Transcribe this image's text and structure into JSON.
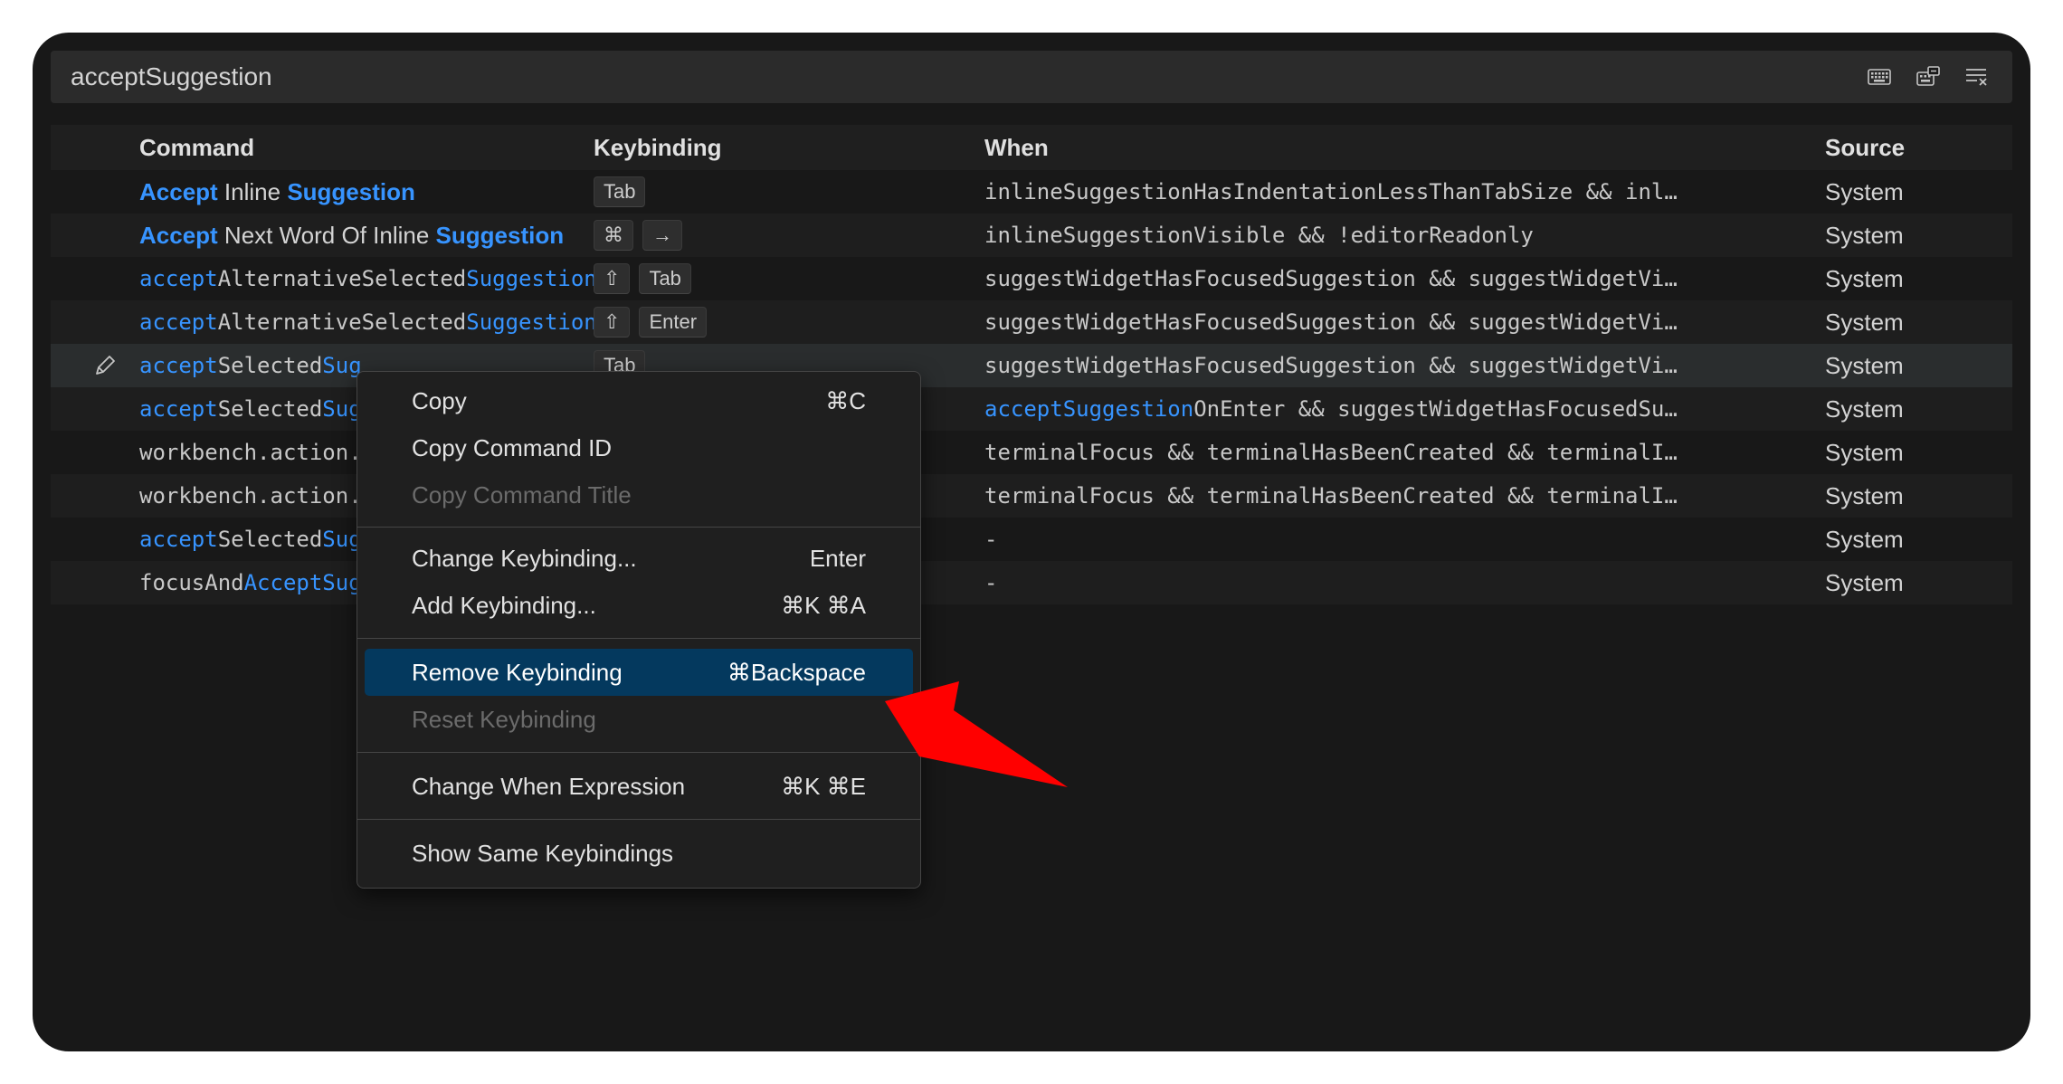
{
  "search": {
    "value": "acceptSuggestion"
  },
  "toolbar": {
    "keyboard_icon": "keyboard-icon",
    "record_keys_icon": "record-keys-icon",
    "clear_icon": "clear-search-icon"
  },
  "table": {
    "headers": {
      "command": "Command",
      "keybinding": "Keybinding",
      "when": "When",
      "source": "Source"
    },
    "rows": [
      {
        "cmd": [
          {
            "t": "Accept",
            "s": "hlb"
          },
          {
            "t": " Inline ",
            "s": "sans"
          },
          {
            "t": "Suggestion",
            "s": "hlb"
          }
        ],
        "keys": [
          "Tab"
        ],
        "when": [
          {
            "t": "inlineSuggestionHasIndentationLessThanTabSize && inl…",
            "s": ""
          }
        ],
        "source": "System"
      },
      {
        "cmd": [
          {
            "t": "Accept",
            "s": "hlb"
          },
          {
            "t": " Next Word Of Inline ",
            "s": "sans"
          },
          {
            "t": "Suggestion",
            "s": "hlb"
          }
        ],
        "keys": [
          "⌘",
          "→"
        ],
        "when": [
          {
            "t": "inlineSuggestionVisible && !editorReadonly",
            "s": ""
          }
        ],
        "source": "System"
      },
      {
        "cmd": [
          {
            "t": "accept",
            "s": "hl"
          },
          {
            "t": "AlternativeSelected",
            "s": ""
          },
          {
            "t": "Suggestion",
            "s": "hl"
          }
        ],
        "keys": [
          "⇧",
          "Tab"
        ],
        "when": [
          {
            "t": "suggestWidgetHasFocusedSuggestion && suggestWidgetVi…",
            "s": ""
          }
        ],
        "source": "System"
      },
      {
        "cmd": [
          {
            "t": "accept",
            "s": "hl"
          },
          {
            "t": "AlternativeSelected",
            "s": ""
          },
          {
            "t": "Suggestion",
            "s": "hl"
          }
        ],
        "keys": [
          "⇧",
          "Enter"
        ],
        "when": [
          {
            "t": "suggestWidgetHasFocusedSuggestion && suggestWidgetVi…",
            "s": ""
          }
        ],
        "source": "System"
      },
      {
        "cmd": [
          {
            "t": "accept",
            "s": "hl"
          },
          {
            "t": "Selected",
            "s": ""
          },
          {
            "t": "Sug",
            "s": "hl"
          }
        ],
        "keys": [
          "Tab"
        ],
        "when": [
          {
            "t": "suggestWidgetHasFocusedSuggestion && suggestWidgetVi…",
            "s": ""
          }
        ],
        "source": "System",
        "focused": true
      },
      {
        "cmd": [
          {
            "t": "accept",
            "s": "hl"
          },
          {
            "t": "Selected",
            "s": ""
          },
          {
            "t": "Sug",
            "s": "hl"
          }
        ],
        "keys": [],
        "when": [
          {
            "t": "acceptSuggestion",
            "s": "hl"
          },
          {
            "t": "OnEnter && suggestWidgetHasFocusedSu…",
            "s": ""
          }
        ],
        "source": "System"
      },
      {
        "cmd": [
          {
            "t": "workbench.action.",
            "s": ""
          }
        ],
        "keys": [],
        "when": [
          {
            "t": "terminalFocus && terminalHasBeenCreated && terminalI…",
            "s": ""
          }
        ],
        "source": "System"
      },
      {
        "cmd": [
          {
            "t": "workbench.action.",
            "s": ""
          }
        ],
        "keys": [],
        "when": [
          {
            "t": "terminalFocus && terminalHasBeenCreated && terminalI…",
            "s": ""
          }
        ],
        "source": "System"
      },
      {
        "cmd": [
          {
            "t": "accept",
            "s": "hl"
          },
          {
            "t": "Selected",
            "s": ""
          },
          {
            "t": "Sug",
            "s": "hl"
          }
        ],
        "keys": [],
        "when": [
          {
            "t": "-",
            "s": ""
          }
        ],
        "source": "System"
      },
      {
        "cmd": [
          {
            "t": "focusAnd",
            "s": ""
          },
          {
            "t": "AcceptSug",
            "s": "hl"
          }
        ],
        "keys": [],
        "when": [
          {
            "t": "-",
            "s": ""
          }
        ],
        "source": "System"
      }
    ]
  },
  "context_menu": {
    "items": [
      {
        "label": "Copy",
        "shortcut": "⌘C",
        "disabled": false
      },
      {
        "label": "Copy Command ID",
        "shortcut": "",
        "disabled": false
      },
      {
        "label": "Copy Command Title",
        "shortcut": "",
        "disabled": true
      },
      {
        "label": "Change Keybinding...",
        "shortcut": "Enter",
        "disabled": false
      },
      {
        "label": "Add Keybinding...",
        "shortcut": "⌘K ⌘A",
        "disabled": false
      },
      {
        "label": "Remove Keybinding",
        "shortcut": "⌘Backspace",
        "disabled": false,
        "selected": true
      },
      {
        "label": "Reset Keybinding",
        "shortcut": "",
        "disabled": true
      },
      {
        "label": "Change When Expression",
        "shortcut": "⌘K ⌘E",
        "disabled": false
      },
      {
        "label": "Show Same Keybindings",
        "shortcut": "",
        "disabled": false
      }
    ]
  },
  "annotation": {
    "arrow_color": "#ff0000"
  }
}
